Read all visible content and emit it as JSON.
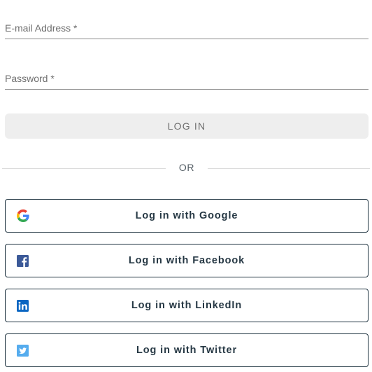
{
  "form": {
    "email_label": "E-mail Address *",
    "password_label": "Password *",
    "login_label": "LOG IN",
    "divider_text": "OR"
  },
  "social": {
    "google": {
      "label": "Log in with Google",
      "icon": "google-icon"
    },
    "facebook": {
      "label": "Log in with Facebook",
      "icon": "facebook-icon",
      "color": "#3b5998"
    },
    "linkedin": {
      "label": "Log in with LinkedIn",
      "icon": "linkedin-icon",
      "color": "#0a66c2"
    },
    "twitter": {
      "label": "Log in with Twitter",
      "icon": "twitter-icon",
      "color": "#55acee"
    }
  }
}
